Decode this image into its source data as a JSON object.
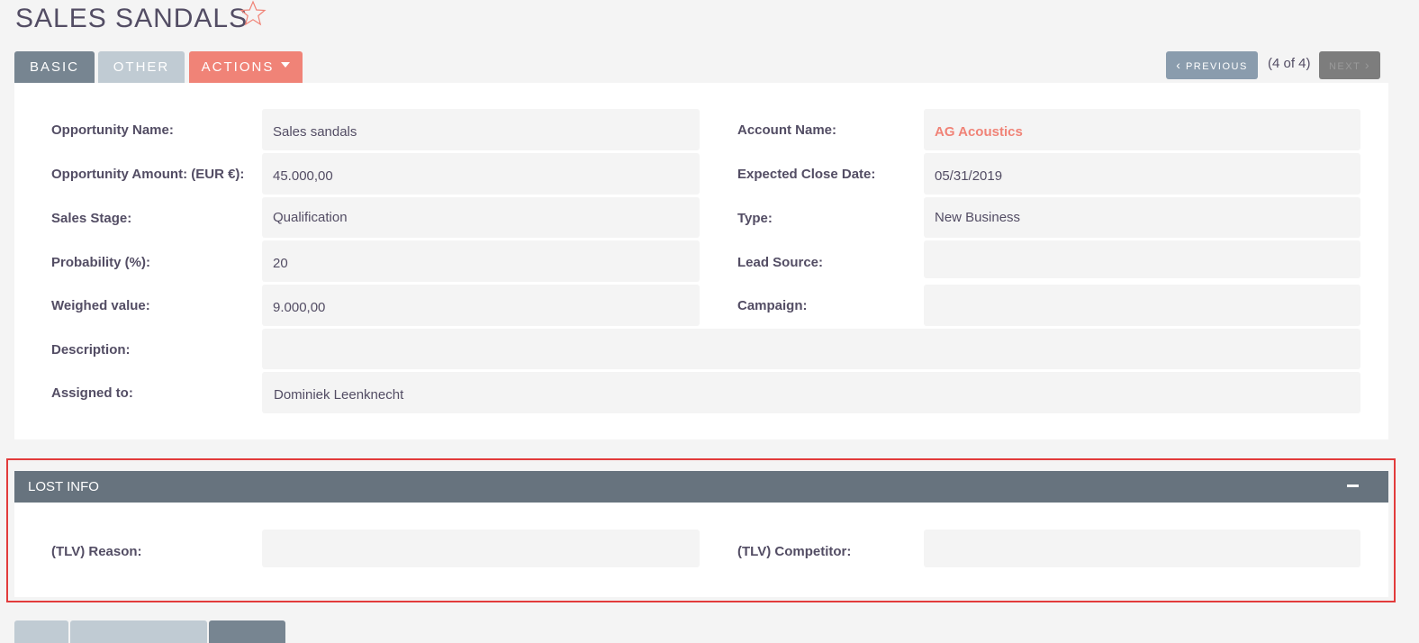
{
  "header": {
    "title": "SALES SANDALS"
  },
  "tabs": [
    {
      "label": "BASIC"
    },
    {
      "label": "OTHER"
    },
    {
      "label": "ACTIONS"
    }
  ],
  "pagination": {
    "previous": "PREVIOUS",
    "position": "(4 of 4)",
    "next": "NEXT"
  },
  "fields": {
    "opportunity_name": {
      "label": "Opportunity Name:",
      "value": "Sales sandals"
    },
    "account_name": {
      "label": "Account Name:",
      "value": "AG Acoustics"
    },
    "opportunity_amount": {
      "label": "Opportunity Amount: (EUR €):",
      "value": "45.000,00"
    },
    "expected_close_date": {
      "label": "Expected Close Date:",
      "value": "05/31/2019"
    },
    "sales_stage": {
      "label": "Sales Stage:",
      "value": "Qualification"
    },
    "type": {
      "label": "Type:",
      "value": "New Business"
    },
    "probability": {
      "label": "Probability (%):",
      "value": "20"
    },
    "lead_source": {
      "label": "Lead Source:",
      "value": ""
    },
    "weighed_value": {
      "label": "Weighed value:",
      "value": "9.000,00"
    },
    "campaign": {
      "label": "Campaign:",
      "value": ""
    },
    "description": {
      "label": "Description:",
      "value": ""
    },
    "assigned_to": {
      "label": "Assigned to:",
      "value": "Dominiek Leenknecht"
    }
  },
  "lost_info": {
    "title": "LOST INFO",
    "reason": {
      "label": "(TLV) Reason:",
      "value": ""
    },
    "competitor": {
      "label": "(TLV) Competitor:",
      "value": ""
    }
  },
  "colors": {
    "accent": "#f08377",
    "tab_active": "#778591",
    "tab_inactive": "#c0cbd3",
    "section_header": "#67737e",
    "highlight": "#e23b3b"
  },
  "icons": {
    "favorite": "star-outline-icon",
    "prev": "chevron-left-icon",
    "next": "chevron-right-icon",
    "collapse": "minus-icon",
    "dropdown": "caret-down-icon"
  }
}
